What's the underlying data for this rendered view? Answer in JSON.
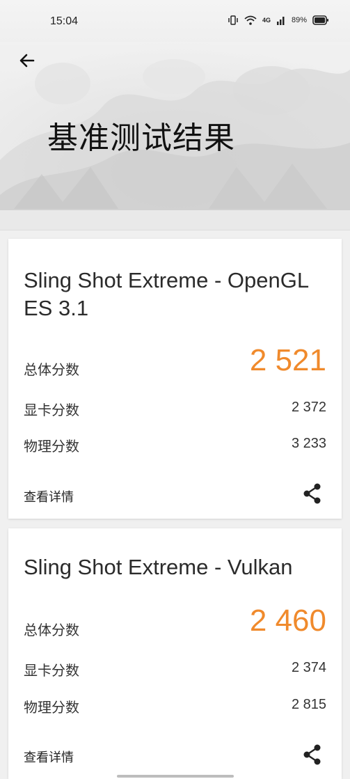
{
  "status_bar": {
    "time": "15:04",
    "network": "4G",
    "battery": "89%"
  },
  "header": {
    "title": "基准测试结果"
  },
  "results": [
    {
      "title": "Sling Shot Extreme - OpenGL ES 3.1",
      "overall_label": "总体分数",
      "overall_value": "2 521",
      "graphics_label": "显卡分数",
      "graphics_value": "2 372",
      "physics_label": "物理分数",
      "physics_value": "3 233",
      "details_label": "查看详情"
    },
    {
      "title": "Sling Shot Extreme - Vulkan",
      "overall_label": "总体分数",
      "overall_value": "2 460",
      "graphics_label": "显卡分数",
      "graphics_value": "2 374",
      "physics_label": "物理分数",
      "physics_value": "2 815",
      "details_label": "查看详情"
    }
  ],
  "colors": {
    "accent": "#f08a2c"
  },
  "icons": {
    "back": "arrow-left-icon",
    "share": "share-icon"
  }
}
